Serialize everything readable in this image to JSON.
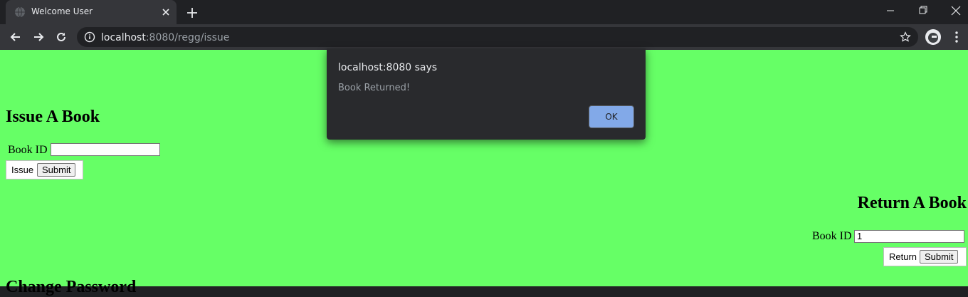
{
  "browser": {
    "tab_title": "Welcome User",
    "url_host": "localhost",
    "url_rest": ":8080/regg/issue"
  },
  "icons": {
    "favicon": "globe-icon",
    "tab_close": "close-icon",
    "new_tab": "plus-icon",
    "back": "arrow-left-icon",
    "forward": "arrow-right-icon",
    "reload": "reload-icon",
    "site_info": "info-icon",
    "bookmark": "star-icon",
    "profile": "avatar",
    "menu": "kebab-menu-icon"
  },
  "page": {
    "background": "#66ff66",
    "issue": {
      "heading": "Issue A Book",
      "field_label": "Book ID",
      "field_value": "",
      "legend": "Issue",
      "submit_label": "Submit"
    },
    "return": {
      "heading": "Return A Book",
      "field_label": "Book ID",
      "field_value": "1",
      "legend": "Return",
      "submit_label": "Submit"
    },
    "change": {
      "heading": "Change Password"
    }
  },
  "alert": {
    "title": "localhost:8080 says",
    "message": "Book Returned!",
    "ok_label": "OK"
  }
}
